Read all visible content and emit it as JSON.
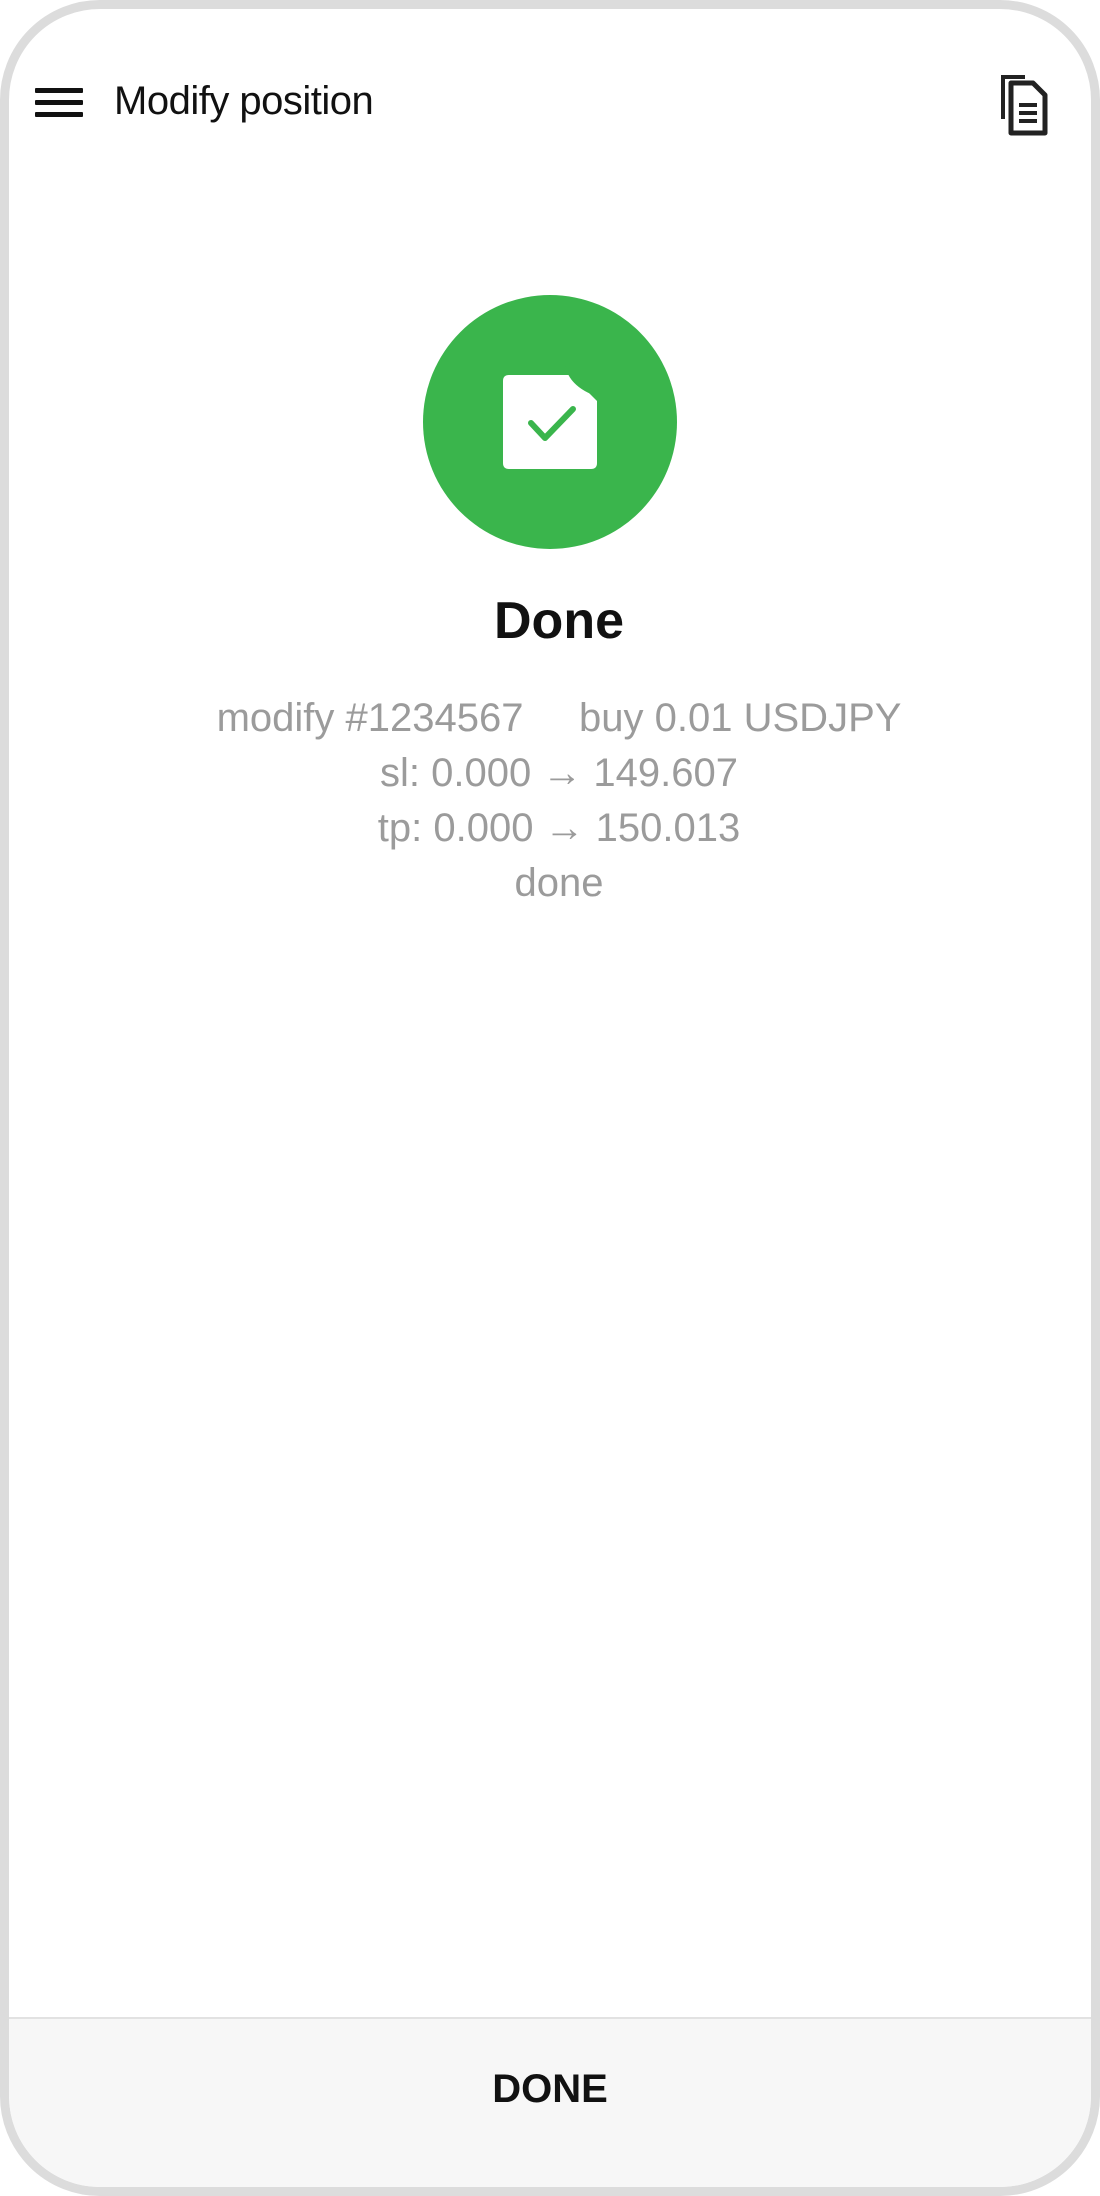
{
  "toolbar": {
    "title": "Modify position",
    "menu_icon": "hamburger-menu-icon",
    "journal_icon": "document-copy-icon"
  },
  "status": {
    "icon": "document-check-icon",
    "color": "#3ab54c",
    "title": "Done"
  },
  "result": {
    "lines": [
      "modify #1234567     buy 0.01 USDJPY",
      "sl: 0.000 → 149.607",
      "tp: 0.000 → 150.013",
      "done"
    ]
  },
  "footer": {
    "done_label": "DONE"
  }
}
